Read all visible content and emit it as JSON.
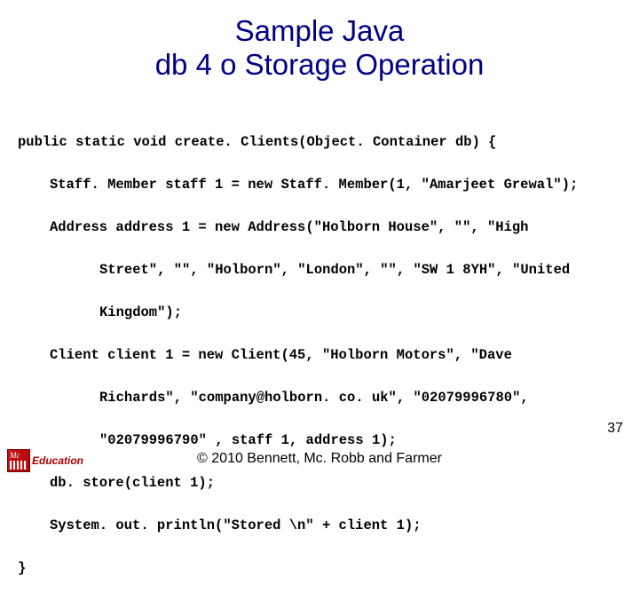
{
  "slide": {
    "title_line1": "Sample Java",
    "title_line2": "db 4 o Storage Operation",
    "page_number": "37",
    "copyright": "© 2010 Bennett, Mc. Robb and Farmer",
    "logo_text": "Education"
  },
  "code": {
    "l0": "public static void create. Clients(Object. Container db) {",
    "l1": "Staff. Member staff 1 = new Staff. Member(1, \"Amarjeet Grewal\");",
    "l2": "Address address 1 = new Address(\"Holborn House\", \"\", \"High",
    "l2b": "Street\", \"\", \"Holborn\", \"London\", \"\", \"SW 1 8YH\", \"United",
    "l2c": "Kingdom\");",
    "l3": "Client client 1 = new Client(45, \"Holborn Motors\", \"Dave",
    "l3b": "Richards\", \"company@holborn. co. uk\", \"02079996780\",",
    "l3c": "\"02079996790\" , staff 1, address 1);",
    "l4": "db. store(client 1);",
    "l5": "System. out. println(\"Stored \\n\" + client 1);",
    "l6": "}"
  }
}
